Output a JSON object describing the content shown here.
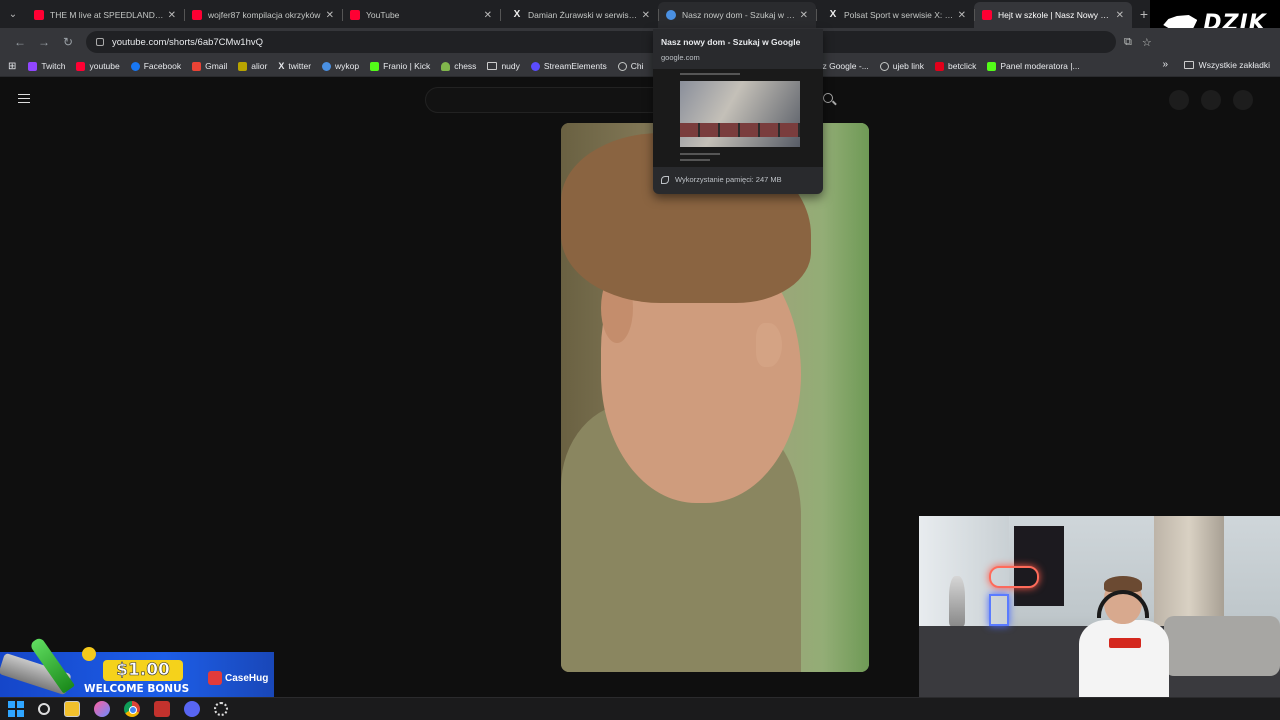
{
  "browser": {
    "tabs": [
      {
        "title": "THE M live at SPEEDLAND FEST",
        "icon": "youtube-icon"
      },
      {
        "title": "wojfer87 kompilacja okrzyków",
        "icon": "youtube-icon"
      },
      {
        "title": "YouTube",
        "icon": "youtube-icon"
      },
      {
        "title": "Damian Żurawski w serwisie X",
        "icon": "x-icon"
      },
      {
        "title": "Nasz nowy dom - Szukaj w Goo",
        "icon": "google-icon",
        "state": "hover"
      },
      {
        "title": "Polsat Sport w serwisie X: „HIS",
        "icon": "x-icon"
      },
      {
        "title": "Hejt w szkole | Nasz Nowy Dom",
        "icon": "youtube-icon",
        "state": "active"
      }
    ],
    "url": "youtube.com/shorts/6ab7CMw1hvQ",
    "bookmarks": [
      {
        "label": "Twitch",
        "color": "#9146ff"
      },
      {
        "label": "youtube",
        "color": "#ff0033"
      },
      {
        "label": "Facebook",
        "color": "#1877f2"
      },
      {
        "label": "Gmail",
        "color": "#ea4335"
      },
      {
        "label": "alior",
        "color": "#b8a400"
      },
      {
        "label": "twitter",
        "color": "#e7e9ea"
      },
      {
        "label": "wykop",
        "color": "#4a90e2"
      },
      {
        "label": "Franio | Kick",
        "color": "#53fc18"
      },
      {
        "label": "chess",
        "color": "#81b64c"
      },
      {
        "label": "nudy",
        "color": "#9aa0a6"
      },
      {
        "label": "StreamElements",
        "color": "#5b4cff"
      },
      {
        "label": "Chi",
        "color": "#c4c7c5"
      },
      {
        "label": "z Google -...",
        "color": "#4285f4"
      },
      {
        "label": "ujeb link",
        "color": "#c4c7c5"
      },
      {
        "label": "betclick",
        "color": "#e2001a"
      },
      {
        "label": "Panel moderatora |...",
        "color": "#53fc18"
      }
    ],
    "all_bookmarks_label": "Wszystkie zakładki"
  },
  "hover_card": {
    "title": "Nasz nowy dom - Szukaj w Google",
    "domain": "google.com",
    "memory": "Wykorzystanie pamięci: 247 MB"
  },
  "overlay": {
    "logo_text": "DZIK",
    "ad": {
      "amount": "$1.00",
      "bonus_text": "WELCOME BONUS",
      "brand": "CaseHug"
    }
  }
}
